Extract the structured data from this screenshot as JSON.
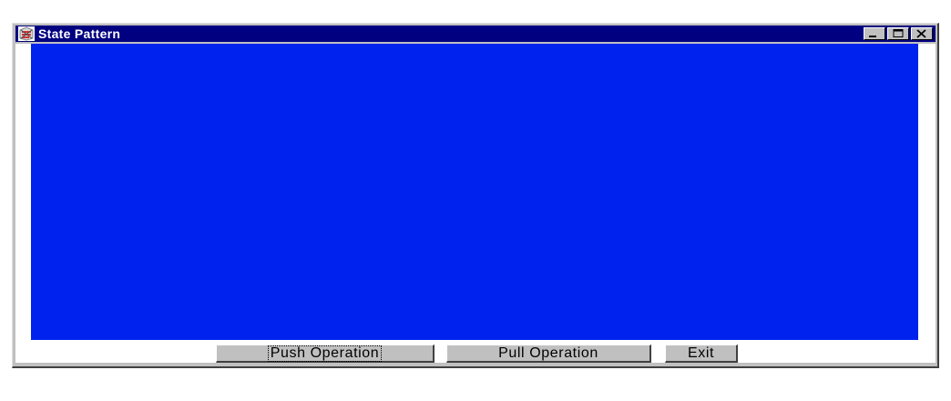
{
  "window": {
    "title": "State Pattern",
    "icon": "java-app-icon",
    "controls": [
      "minimize-icon",
      "maximize-icon",
      "close-icon"
    ]
  },
  "canvas": {
    "fill_color": "#0022ee"
  },
  "buttons": {
    "push_label": "Push Operation",
    "pull_label": "Pull Operation",
    "exit_label": "Exit",
    "focused": "Push Operation"
  },
  "colors": {
    "title_bar": "#000080",
    "window_face": "#c0c0c0",
    "canvas": "#0022ee"
  }
}
